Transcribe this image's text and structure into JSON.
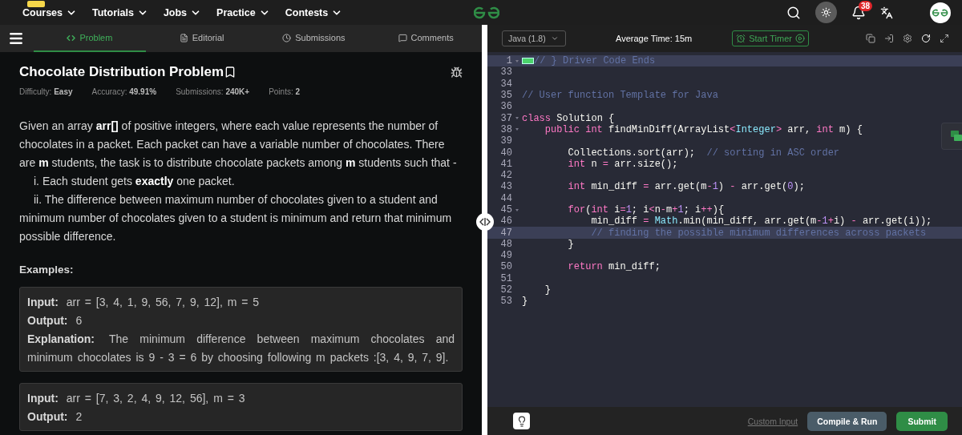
{
  "nav": {
    "items": [
      {
        "label": "Courses",
        "tagged": true
      },
      {
        "label": "Tutorials",
        "tagged": false
      },
      {
        "label": "Jobs",
        "tagged": false
      },
      {
        "label": "Practice",
        "tagged": false
      },
      {
        "label": "Contests",
        "tagged": false
      }
    ],
    "notification_count": "38"
  },
  "tabs": [
    {
      "label": "Problem",
      "selected": true
    },
    {
      "label": "Editorial",
      "selected": false
    },
    {
      "label": "Submissions",
      "selected": false
    },
    {
      "label": "Comments",
      "selected": false
    }
  ],
  "problem": {
    "title": "Chocolate Distribution Problem",
    "meta": [
      {
        "label": "Difficulty:",
        "value": "Easy"
      },
      {
        "label": "Accuracy:",
        "value": "49.91%"
      },
      {
        "label": "Submissions:",
        "value": "240K+"
      },
      {
        "label": "Points:",
        "value": "2"
      }
    ],
    "description": [
      {
        "kind": "paragraph",
        "text": "Given an array **arr[]** of positive integers, where each value represents the number of chocolates in a packet. Each packet can have a variable number of chocolates. There are **m** students, the task is to distribute chocolate packets among **m** students such that -"
      },
      {
        "kind": "list-item",
        "text": "i. Each student gets **exactly** one packet."
      },
      {
        "kind": "list-item",
        "text": "ii. The difference between maximum number of chocolates given to a student and minimum number of chocolates given to a student is minimum and return that minimum possible difference."
      }
    ],
    "examples_heading": "Examples:",
    "examples": [
      {
        "lines": [
          {
            "label": "Input:",
            "text": "arr = [3, 4, 1, 9, 56, 7, 9, 12], m = 5"
          },
          {
            "label": "Output:",
            "text": "6"
          },
          {
            "label": "Explanation:",
            "text": "The minimum difference between maximum chocolates and minimum chocolates is 9 - 3 = 6 by choosing following m packets :[3, 4, 9, 7, 9]."
          }
        ]
      },
      {
        "lines": [
          {
            "label": "Input:",
            "text": "arr = [7, 3, 2, 4, 9, 12, 56], m = 3"
          },
          {
            "label": "Output:",
            "text": "2"
          }
        ]
      }
    ]
  },
  "editor": {
    "language": "Java (1.8)",
    "average_time": "Average Time: 15m",
    "timer_button": "Start Timer",
    "lines": [
      {
        "number": "1",
        "foldable": true,
        "folded": true,
        "highlighted": true,
        "tokens": [
          {
            "kind": "comment",
            "text": "// } Driver Code Ends"
          }
        ]
      },
      {
        "number": "33",
        "foldable": false,
        "folded": false,
        "highlighted": false
      },
      {
        "number": "34",
        "foldable": false,
        "folded": false,
        "highlighted": false
      },
      {
        "number": "35",
        "foldable": false,
        "folded": false,
        "highlighted": false,
        "tokens": [
          {
            "kind": "comment",
            "text": "// User function Template for Java"
          }
        ]
      },
      {
        "number": "36",
        "foldable": false,
        "folded": false,
        "highlighted": false
      },
      {
        "number": "37",
        "foldable": true,
        "folded": false,
        "highlighted": false,
        "tokens": [
          {
            "kind": "keyword",
            "text": "class"
          },
          {
            "kind": "plain",
            "text": " Solution {"
          }
        ]
      },
      {
        "number": "38",
        "foldable": true,
        "folded": false,
        "highlighted": false,
        "tokens": [
          {
            "kind": "keyword",
            "text": "    public"
          },
          {
            "kind": "keyword",
            "text": " int"
          },
          {
            "kind": "plain",
            "text": " findMinDiff(ArrayList"
          },
          {
            "kind": "keyword",
            "text": "<"
          },
          {
            "kind": "type",
            "text": "Integer"
          },
          {
            "kind": "keyword",
            "text": ">"
          },
          {
            "kind": "plain",
            "text": " arr, "
          },
          {
            "kind": "keyword",
            "text": "int"
          },
          {
            "kind": "plain",
            "text": " m) {"
          }
        ]
      },
      {
        "number": "39",
        "foldable": false,
        "folded": false,
        "highlighted": false
      },
      {
        "number": "40",
        "foldable": false,
        "folded": false,
        "highlighted": false,
        "tokens": [
          {
            "kind": "plain",
            "text": "        Collections.sort(arr);  "
          },
          {
            "kind": "comment",
            "text": "// sorting in ASC order"
          }
        ]
      },
      {
        "number": "41",
        "foldable": false,
        "folded": false,
        "highlighted": false,
        "tokens": [
          {
            "kind": "keyword",
            "text": "        int"
          },
          {
            "kind": "plain",
            "text": " n "
          },
          {
            "kind": "keyword",
            "text": "="
          },
          {
            "kind": "plain",
            "text": " arr.size();"
          }
        ]
      },
      {
        "number": "42",
        "foldable": false,
        "folded": false,
        "highlighted": false
      },
      {
        "number": "43",
        "foldable": false,
        "folded": false,
        "highlighted": false,
        "tokens": [
          {
            "kind": "keyword",
            "text": "        int"
          },
          {
            "kind": "plain",
            "text": " min_diff "
          },
          {
            "kind": "keyword",
            "text": "="
          },
          {
            "kind": "plain",
            "text": " arr.get(m"
          },
          {
            "kind": "keyword",
            "text": "-"
          },
          {
            "kind": "number",
            "text": "1"
          },
          {
            "kind": "plain",
            "text": ") "
          },
          {
            "kind": "keyword",
            "text": "-"
          },
          {
            "kind": "plain",
            "text": " arr.get("
          },
          {
            "kind": "number",
            "text": "0"
          },
          {
            "kind": "plain",
            "text": ");"
          }
        ]
      },
      {
        "number": "44",
        "foldable": false,
        "folded": false,
        "highlighted": false
      },
      {
        "number": "45",
        "foldable": true,
        "folded": false,
        "highlighted": false,
        "tokens": [
          {
            "kind": "keyword",
            "text": "        for"
          },
          {
            "kind": "plain",
            "text": "("
          },
          {
            "kind": "keyword",
            "text": "int"
          },
          {
            "kind": "plain",
            "text": " i"
          },
          {
            "kind": "keyword",
            "text": "="
          },
          {
            "kind": "number",
            "text": "1"
          },
          {
            "kind": "plain",
            "text": "; i"
          },
          {
            "kind": "keyword",
            "text": "<"
          },
          {
            "kind": "plain",
            "text": "n"
          },
          {
            "kind": "keyword",
            "text": "-"
          },
          {
            "kind": "plain",
            "text": "m"
          },
          {
            "kind": "keyword",
            "text": "+"
          },
          {
            "kind": "number",
            "text": "1"
          },
          {
            "kind": "plain",
            "text": "; i"
          },
          {
            "kind": "keyword",
            "text": "++"
          },
          {
            "kind": "plain",
            "text": "){"
          }
        ]
      },
      {
        "number": "46",
        "foldable": false,
        "folded": false,
        "highlighted": false,
        "tokens": [
          {
            "kind": "plain",
            "text": "            min_diff "
          },
          {
            "kind": "keyword",
            "text": "="
          },
          {
            "kind": "type",
            "text": " Math"
          },
          {
            "kind": "plain",
            "text": ".min(min_diff, arr.get(m"
          },
          {
            "kind": "keyword",
            "text": "-"
          },
          {
            "kind": "number",
            "text": "1"
          },
          {
            "kind": "keyword",
            "text": "+"
          },
          {
            "kind": "plain",
            "text": "i) "
          },
          {
            "kind": "keyword",
            "text": "-"
          },
          {
            "kind": "plain",
            "text": " arr.get(i));"
          }
        ]
      },
      {
        "number": "47",
        "foldable": false,
        "folded": false,
        "highlighted": true,
        "tokens": [
          {
            "kind": "comment",
            "text": "            // finding the possible minimum differences across packets"
          }
        ]
      },
      {
        "number": "48",
        "foldable": false,
        "folded": false,
        "highlighted": false,
        "tokens": [
          {
            "kind": "plain",
            "text": "        }"
          }
        ]
      },
      {
        "number": "49",
        "foldable": false,
        "folded": false,
        "highlighted": false
      },
      {
        "number": "50",
        "foldable": false,
        "folded": false,
        "highlighted": false,
        "tokens": [
          {
            "kind": "keyword",
            "text": "        return"
          },
          {
            "kind": "plain",
            "text": " min_diff;"
          }
        ]
      },
      {
        "number": "51",
        "foldable": false,
        "folded": false,
        "highlighted": false
      },
      {
        "number": "52",
        "foldable": false,
        "folded": false,
        "highlighted": false,
        "tokens": [
          {
            "kind": "plain",
            "text": "    }"
          }
        ]
      },
      {
        "number": "53",
        "foldable": false,
        "folded": false,
        "highlighted": false,
        "tokens": [
          {
            "kind": "plain",
            "text": "}"
          }
        ]
      }
    ]
  },
  "footer": {
    "custom_input": "Custom Input",
    "compile_button": "Compile & Run",
    "submit_button": "Submit"
  }
}
